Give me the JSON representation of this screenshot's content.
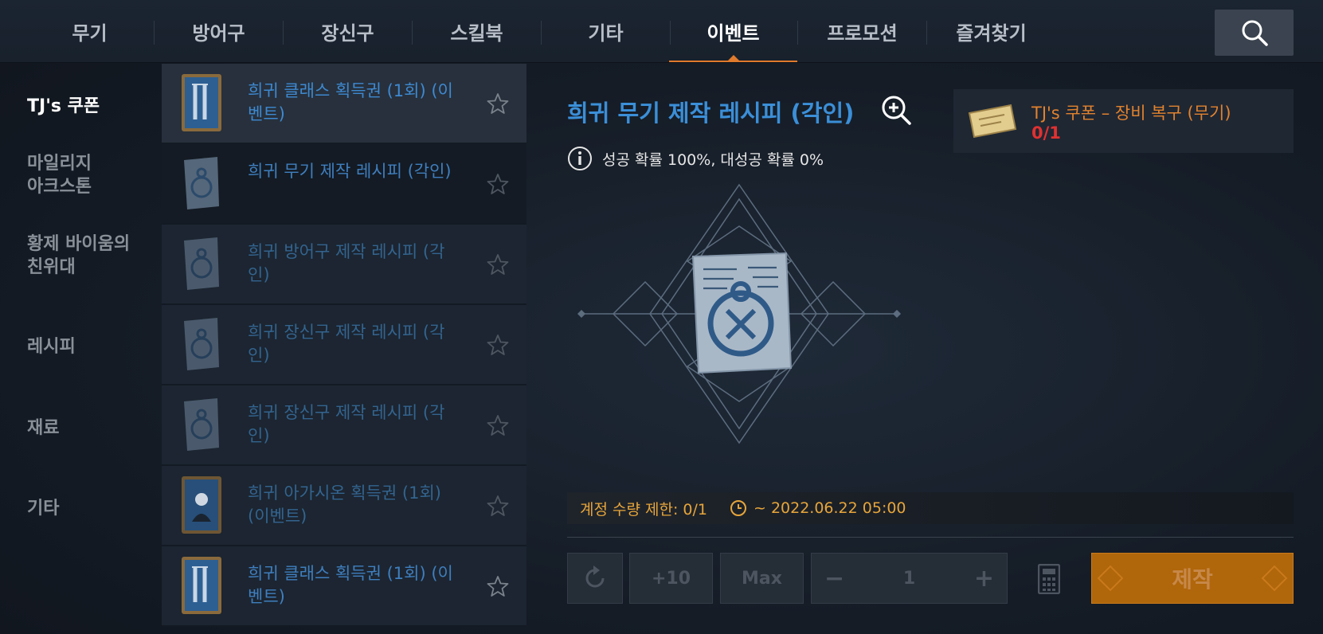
{
  "tabs": [
    {
      "label": "무기",
      "active": false
    },
    {
      "label": "방어구",
      "active": false
    },
    {
      "label": "장신구",
      "active": false
    },
    {
      "label": "스킬북",
      "active": false
    },
    {
      "label": "기타",
      "active": false
    },
    {
      "label": "이벤트",
      "active": true
    },
    {
      "label": "프로모션",
      "active": false
    },
    {
      "label": "즐겨찾기",
      "active": false
    }
  ],
  "search": {
    "icon": "search-icon"
  },
  "categories": [
    {
      "label": "TJ's 쿠폰",
      "active": true
    },
    {
      "label": "마일리지\n아크스톤",
      "active": false
    },
    {
      "label": "황제 바이움의\n친위대",
      "active": false
    },
    {
      "label": "레시피",
      "active": false
    },
    {
      "label": "재료",
      "active": false
    },
    {
      "label": "기타",
      "active": false
    }
  ],
  "items": [
    {
      "name": "희귀 클래스 획득권 (1회) (이벤트)",
      "icon": "class-card-icon"
    },
    {
      "name": "희귀 무기 제작 레시피 (각인)",
      "icon": "recipe-scroll-icon"
    },
    {
      "name": "희귀 방어구 제작 레시피 (각인)",
      "icon": "recipe-scroll-icon"
    },
    {
      "name": "희귀 장신구 제작 레시피 (각인)",
      "icon": "recipe-scroll-icon"
    },
    {
      "name": "희귀 장신구 제작 레시피 (각인)",
      "icon": "recipe-scroll-icon"
    },
    {
      "name": "희귀 아가시온 획득권 (1회) (이벤트)",
      "icon": "agathion-card-icon"
    },
    {
      "name": "희귀 클래스 획득권 (1회) (이벤트)",
      "icon": "class-card-icon"
    }
  ],
  "detail": {
    "title": "희귀 무기 제작 레시피 (각인)",
    "info": "성공 확률 100%, 대성공 확률 0%",
    "requirement": {
      "name": "TJ's 쿠폰 – 장비 복구 (무기)",
      "count": "0/1"
    },
    "limit": "계정 수량 제한: 0/1",
    "period": "~ 2022.06.22 05:00"
  },
  "controls": {
    "plus10": "+10",
    "max": "Max",
    "quantity": "1",
    "craft": "제작"
  },
  "colors": {
    "accent": "#e07a2c",
    "title_blue": "#3b8fd8",
    "requirement_orange": "#e1822e",
    "count_red": "#e03131",
    "limit_yellow": "#e7a53a",
    "craft_button": "#b0660a"
  }
}
